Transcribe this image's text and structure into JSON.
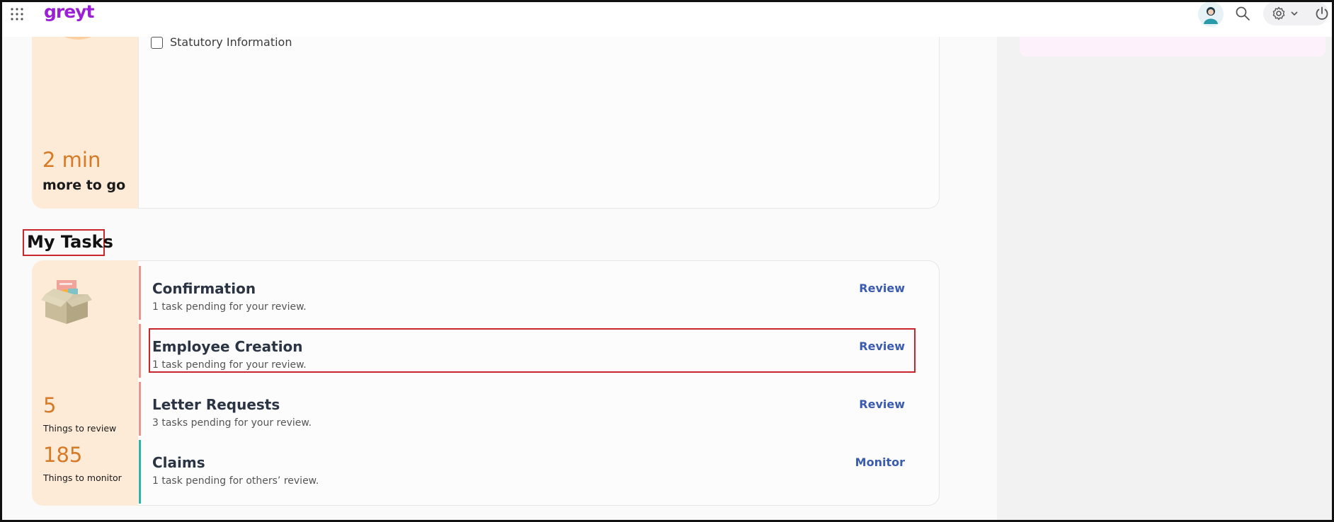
{
  "app": {
    "logo_text": "greyt"
  },
  "colors": {
    "brand": "#9b1fd6",
    "accent_orange": "#d67a26",
    "link_blue": "#3a5bb0",
    "bar_review": "#e8968c",
    "bar_monitor": "#2bb3a3"
  },
  "header": {
    "icons": [
      "apps-grid-icon",
      "avatar",
      "search-icon",
      "gear-icon",
      "chevron-down-icon",
      "power-icon"
    ]
  },
  "setup": {
    "checkbox_label": "Statutory Information",
    "time_value": "2 min",
    "time_label": "more to go"
  },
  "tasks": {
    "heading": "My Tasks",
    "review_count": "5",
    "review_label": "Things to review",
    "monitor_count": "185",
    "monitor_label": "Things to monitor",
    "items": [
      {
        "title": "Confirmation",
        "subtitle": "1 task pending for your review.",
        "action": "Review"
      },
      {
        "title": "Employee Creation",
        "subtitle": "1 task pending for your review.",
        "action": "Review"
      },
      {
        "title": "Letter Requests",
        "subtitle": "3 tasks pending for your review.",
        "action": "Review"
      },
      {
        "title": "Claims",
        "subtitle": "1 task pending for others’ review.",
        "action": "Monitor"
      }
    ]
  }
}
